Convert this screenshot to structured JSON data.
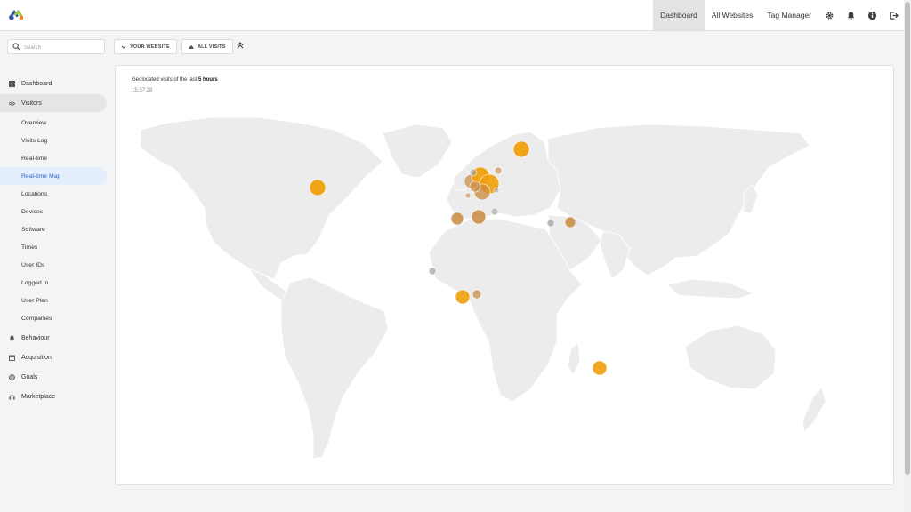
{
  "header": {
    "nav": [
      {
        "label": "Dashboard",
        "active": true
      },
      {
        "label": "All Websites",
        "active": false
      },
      {
        "label": "Tag Manager",
        "active": false
      }
    ],
    "icons": [
      "gear-icon",
      "bell-icon",
      "info-icon",
      "logout-icon"
    ]
  },
  "search": {
    "placeholder": "Search",
    "value": ""
  },
  "selectors": {
    "site_label": "YOUR WEBSITE",
    "segment_label": "ALL VISITS"
  },
  "sidebar": {
    "categories": [
      {
        "label": "Dashboard",
        "icon": "grid-icon"
      },
      {
        "label": "Visitors",
        "icon": "eye-icon",
        "open": true
      },
      {
        "label": "Behaviour",
        "icon": "bell-icon"
      },
      {
        "label": "Acquisition",
        "icon": "calendar-icon"
      },
      {
        "label": "Goals",
        "icon": "target-icon"
      },
      {
        "label": "Marketplace",
        "icon": "headset-icon"
      }
    ],
    "visitors_items": [
      {
        "label": "Overview"
      },
      {
        "label": "Visits Log"
      },
      {
        "label": "Real-time"
      },
      {
        "label": "Real-time Map",
        "active": true
      },
      {
        "label": "Locations"
      },
      {
        "label": "Devices"
      },
      {
        "label": "Software"
      },
      {
        "label": "Times"
      },
      {
        "label": "User IDs"
      },
      {
        "label": "Logged In"
      },
      {
        "label": "User Plan"
      },
      {
        "label": "Companies"
      }
    ]
  },
  "map": {
    "heading_prefix": "Geolocated visits of the last",
    "heading_value": "5 hours",
    "clock": "15:37:28",
    "colors": {
      "land": "#ececec",
      "border": "#ffffff",
      "recent": "#f0a00c",
      "older": "#c98a3e",
      "stale": "#9e9e9e"
    }
  }
}
